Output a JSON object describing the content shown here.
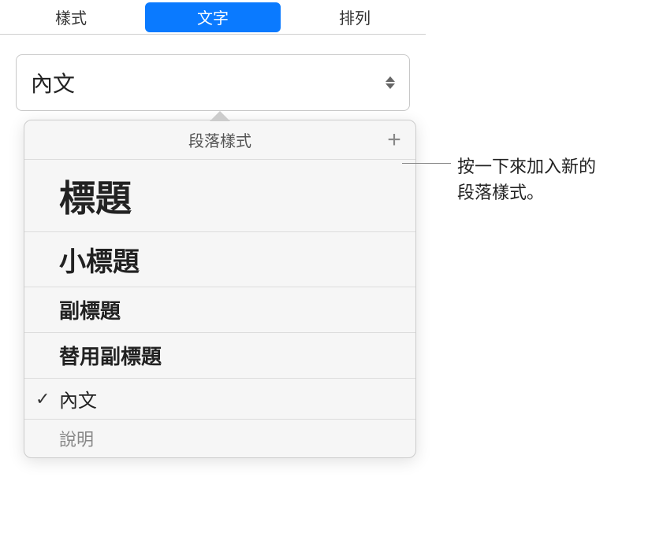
{
  "tabs": {
    "style": "樣式",
    "text": "文字",
    "arrange": "排列"
  },
  "dropdown": {
    "current": "內文"
  },
  "popover": {
    "title": "段落樣式",
    "items": [
      {
        "label": "標題",
        "cls": "title",
        "checked": false
      },
      {
        "label": "小標題",
        "cls": "subtitle",
        "checked": false
      },
      {
        "label": "副標題",
        "cls": "heading2",
        "checked": false
      },
      {
        "label": "替用副標題",
        "cls": "heading3",
        "checked": false
      },
      {
        "label": "內文",
        "cls": "body",
        "checked": true
      },
      {
        "label": "說明",
        "cls": "caption",
        "checked": false
      }
    ]
  },
  "callout": {
    "line1": "按一下來加入新的",
    "line2": "段落樣式。"
  }
}
